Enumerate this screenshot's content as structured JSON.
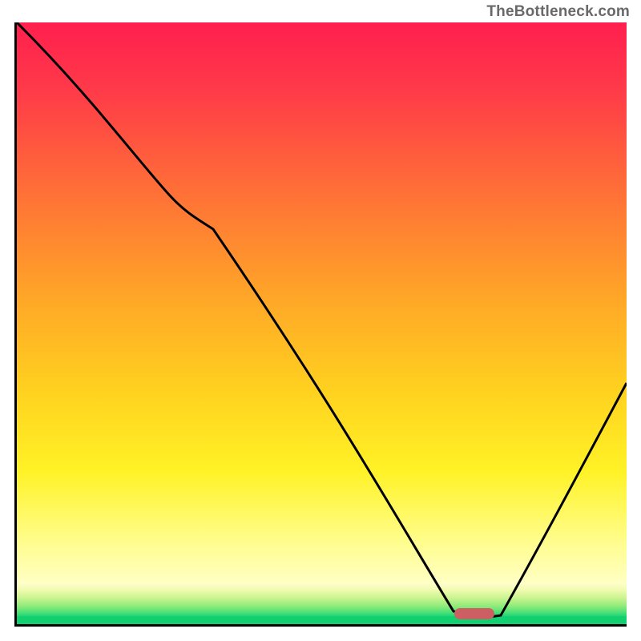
{
  "attribution": "TheBottleneck.com",
  "chart_data": {
    "type": "line",
    "title": "",
    "xlabel": "",
    "ylabel": "",
    "xlim": [
      0,
      100
    ],
    "ylim": [
      0,
      100
    ],
    "grid": false,
    "legend": false,
    "series": [
      {
        "name": "curve",
        "x": [
          0,
          12,
          25,
          32,
          55,
          72,
          75,
          79,
          100
        ],
        "y": [
          100,
          87,
          71,
          65,
          25,
          2,
          1,
          2,
          40
        ]
      }
    ],
    "annotations": [
      {
        "name": "valley-marker",
        "x_range": [
          72,
          79
        ],
        "y": 1
      }
    ],
    "gradient_bands": [
      {
        "name": "red",
        "y_range": [
          88,
          100
        ],
        "color": "#ff1f4e"
      },
      {
        "name": "orange",
        "y_range": [
          55,
          88
        ],
        "color": "#ff8a2e"
      },
      {
        "name": "yellow",
        "y_range": [
          18,
          55
        ],
        "color": "#ffe21f"
      },
      {
        "name": "pale-yellow",
        "y_range": [
          7,
          18
        ],
        "color": "#fffdb0"
      },
      {
        "name": "yellow-green",
        "y_range": [
          2,
          7
        ],
        "color": "#a8ef86"
      },
      {
        "name": "green",
        "y_range": [
          0,
          2
        ],
        "color": "#12cf70"
      }
    ]
  }
}
